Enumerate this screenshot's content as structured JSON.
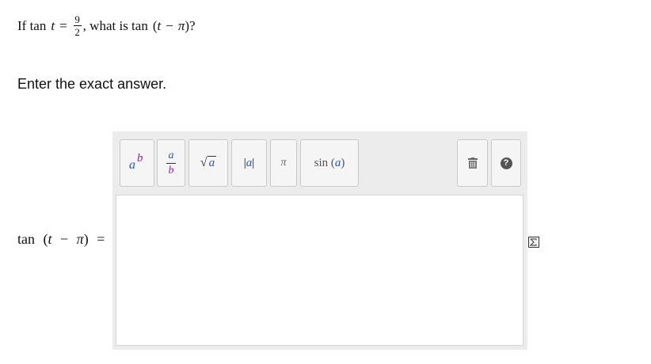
{
  "question": {
    "prefix": "If tan",
    "var": "t",
    "equals": "=",
    "numerator": "9",
    "denominator": "2",
    "suffix_text": ", what is tan",
    "expr_open": "(",
    "expr_var": "t",
    "expr_minus": "−",
    "expr_pi": "π",
    "expr_close": ")?"
  },
  "instruction": "Enter the exact answer.",
  "toolbar": {
    "exponent": {
      "base": "a",
      "exp": "b"
    },
    "fraction": {
      "num": "a",
      "den": "b"
    },
    "sqrt": {
      "radical": "√",
      "arg": "a"
    },
    "abs": {
      "open": "|",
      "arg": "a",
      "close": "|"
    },
    "pi": "π",
    "sin": {
      "fn": "sin",
      "open": "(",
      "arg": "a",
      "close": ")"
    },
    "trash_icon": "trash-icon",
    "help_glyph": "?"
  },
  "answer_label": {
    "fn": "tan",
    "open": "(",
    "var": "t",
    "minus": "−",
    "pi": "π",
    "close": ")",
    "equals": "="
  },
  "answer_value": "",
  "side_icon": "equation-editor-icon"
}
